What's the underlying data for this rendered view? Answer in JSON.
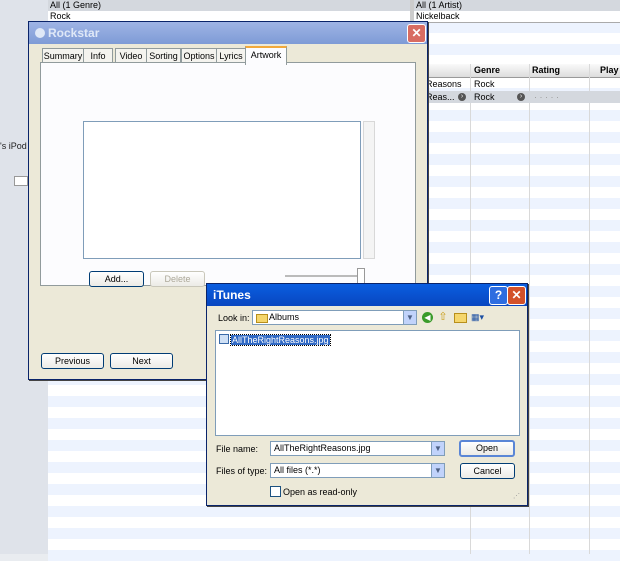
{
  "background": {
    "genre_browser": {
      "all_label": "All (1 Genre)",
      "item": "Rock"
    },
    "artist_browser": {
      "all_label": "All (1 Artist)",
      "item": "Nickelback"
    },
    "sidebar": {
      "ipod_label": "'s iPod"
    },
    "columns": {
      "genre": "Genre",
      "rating": "Rating",
      "play": "Play"
    },
    "rows": [
      {
        "name": "Reasons",
        "genre": "Rock"
      },
      {
        "name": "Reas...",
        "genre": "Rock",
        "rating": "· · · · ·"
      }
    ]
  },
  "rockstar": {
    "title": "Rockstar",
    "tabs": [
      "Summary",
      "Info",
      "Video",
      "Sorting",
      "Options",
      "Lyrics",
      "Artwork"
    ],
    "active_tab": "Artwork",
    "add_label": "Add...",
    "delete_label": "Delete",
    "previous_label": "Previous",
    "next_label": "Next"
  },
  "dialog": {
    "title": "iTunes",
    "help_label": "?",
    "close_label": "✕",
    "look_in_label": "Look in:",
    "look_in_value": "Albums",
    "file": "AllTheRightReasons.jpg",
    "file_name_label": "File name:",
    "file_name_value": "AllTheRightReasons.jpg",
    "files_of_type_label": "Files of type:",
    "files_of_type_value": "All files (*.*)",
    "open_label": "Open",
    "cancel_label": "Cancel",
    "readonly_label": "Open as read-only"
  }
}
